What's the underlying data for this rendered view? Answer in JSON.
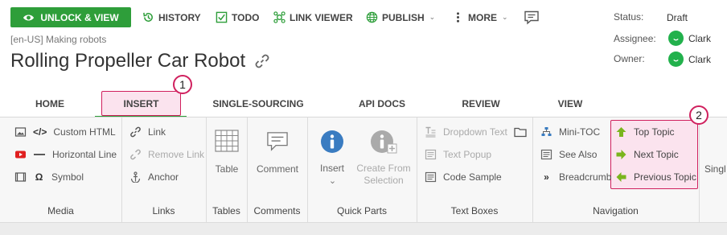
{
  "toolbar": {
    "unlock_label": "UNLOCK & VIEW",
    "history_label": "HISTORY",
    "todo_label": "TODO",
    "link_viewer_label": "LINK VIEWER",
    "publish_label": "PUBLISH",
    "more_label": "MORE"
  },
  "topic": {
    "breadcrumb": "[en-US] Making robots",
    "title": "Rolling Propeller Car Robot"
  },
  "meta": {
    "status_label": "Status:",
    "status_value": "Draft",
    "assignee_label": "Assignee:",
    "assignee_name": "Clark",
    "owner_label": "Owner:",
    "owner_name": "Clark"
  },
  "tabs": [
    "HOME",
    "INSERT",
    "SINGLE-SOURCING",
    "API DOCS",
    "REVIEW",
    "VIEW"
  ],
  "active_tab": "INSERT",
  "callouts": [
    "1",
    "2"
  ],
  "ribbon": {
    "media": {
      "items": [
        "Custom HTML",
        "Horizontal Line",
        "Symbol"
      ],
      "label": "Media"
    },
    "links": {
      "items": [
        "Link",
        "Remove Link",
        "Anchor"
      ],
      "label": "Links"
    },
    "tables": {
      "button": "Table",
      "label": "Tables"
    },
    "comments": {
      "button": "Comment",
      "label": "Comments"
    },
    "quick_parts": {
      "insert": "Insert",
      "create_line1": "Create From",
      "create_line2": "Selection",
      "label": "Quick Parts"
    },
    "text_boxes": {
      "items": [
        "Dropdown Text",
        "Text Popup",
        "Code Sample"
      ],
      "label": "Text Boxes"
    },
    "navigation": {
      "items": [
        "Mini-TOC",
        "See Also",
        "Breadcrumb"
      ],
      "topic_items": [
        "Top Topic",
        "Next Topic",
        "Previous Topic"
      ],
      "label": "Navigation"
    },
    "truncated_label": "Singl"
  },
  "colors": {
    "accent_green": "#2e9e3a",
    "highlight_pink": "#d0205e",
    "highlight_fill": "#fbe3ee",
    "nav_arrow_green": "#7ab51d"
  }
}
